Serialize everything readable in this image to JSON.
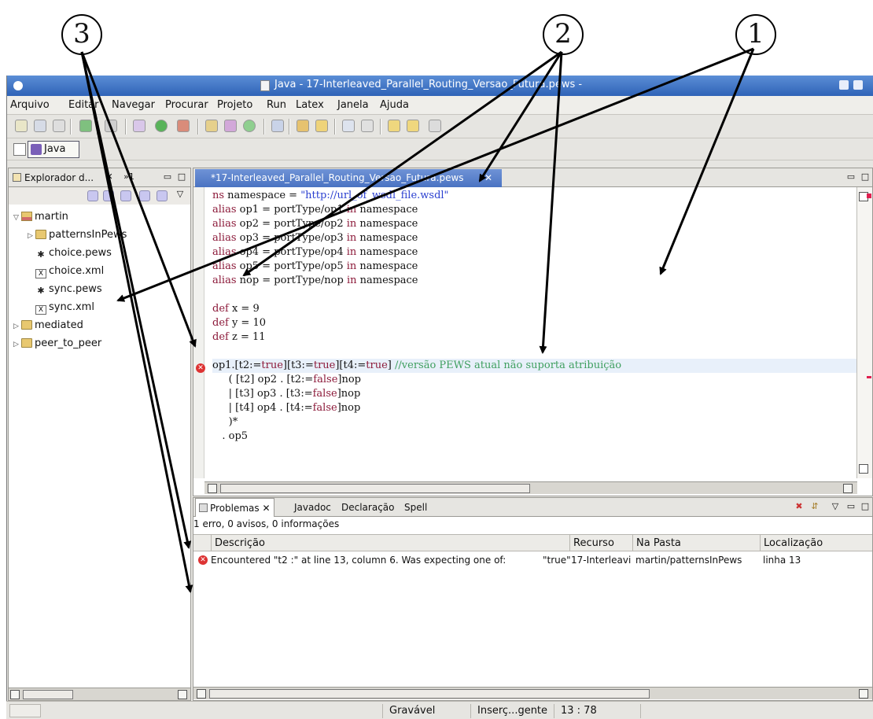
{
  "callouts": [
    "3",
    "2",
    "1"
  ],
  "window": {
    "title": "Java - 17-Interleaved_Parallel_Routing_Versao_Futura.pews -"
  },
  "menu": [
    "Arquivo",
    "Editar",
    "Navegar",
    "Procurar",
    "Projeto",
    "Run",
    "Latex",
    "Janela",
    "Ajuda"
  ],
  "perspective": {
    "java_label": "Java"
  },
  "explorer": {
    "title": "Explorador d...",
    "overflow": "»1",
    "tree": [
      {
        "label": "martin",
        "type": "project",
        "depth": 0,
        "twisty": "▽"
      },
      {
        "label": "patternsInPews",
        "type": "folder",
        "depth": 1,
        "twisty": "▷"
      },
      {
        "label": "choice.pews",
        "type": "pews",
        "depth": 1,
        "twisty": ""
      },
      {
        "label": "choice.xml",
        "type": "xml",
        "depth": 1,
        "twisty": ""
      },
      {
        "label": "sync.pews",
        "type": "pews",
        "depth": 1,
        "twisty": ""
      },
      {
        "label": "sync.xml",
        "type": "xml",
        "depth": 1,
        "twisty": ""
      },
      {
        "label": "mediated",
        "type": "folder",
        "depth": 0,
        "twisty": "▷"
      },
      {
        "label": "peer_to_peer",
        "type": "folder",
        "depth": 0,
        "twisty": "▷"
      }
    ]
  },
  "editor": {
    "tab_label": "*17-Interleaved_Parallel_Routing_Versao_Futura.pews",
    "code": [
      [
        [
          "kw",
          "ns"
        ],
        [
          "t",
          " namespace = "
        ],
        [
          "str",
          "\"http://url_of_wsdl_file.wsdl\""
        ]
      ],
      [
        [
          "kw",
          "alias"
        ],
        [
          "t",
          " op1 = portType/op1 "
        ],
        [
          "kw",
          "in"
        ],
        [
          "t",
          " namespace"
        ]
      ],
      [
        [
          "kw",
          "alias"
        ],
        [
          "t",
          " op2 = portType/op2 "
        ],
        [
          "kw",
          "in"
        ],
        [
          "t",
          " namespace"
        ]
      ],
      [
        [
          "kw",
          "alias"
        ],
        [
          "t",
          " op3 = portType/op3 "
        ],
        [
          "kw",
          "in"
        ],
        [
          "t",
          " namespace"
        ]
      ],
      [
        [
          "kw",
          "alias"
        ],
        [
          "t",
          " op4 = portType/op4 "
        ],
        [
          "kw",
          "in"
        ],
        [
          "t",
          " namespace"
        ]
      ],
      [
        [
          "kw",
          "alias"
        ],
        [
          "t",
          " op5 = portType/op5 "
        ],
        [
          "kw",
          "in"
        ],
        [
          "t",
          " namespace"
        ]
      ],
      [
        [
          "kw",
          "alias"
        ],
        [
          "t",
          " nop = portType/nop "
        ],
        [
          "kw",
          "in"
        ],
        [
          "t",
          " namespace"
        ]
      ],
      [
        [
          "t",
          ""
        ]
      ],
      [
        [
          "kw",
          "def"
        ],
        [
          "t",
          " x = 9"
        ]
      ],
      [
        [
          "kw",
          "def"
        ],
        [
          "t",
          " y = 10"
        ]
      ],
      [
        [
          "kw",
          "def"
        ],
        [
          "t",
          " z = 11"
        ]
      ],
      [
        [
          "t",
          ""
        ]
      ],
      [
        [
          "t",
          "op1.[t2:="
        ],
        [
          "kw",
          "true"
        ],
        [
          "t",
          "][t3:="
        ],
        [
          "kw",
          "true"
        ],
        [
          "t",
          "][t4:="
        ],
        [
          "kw",
          "true"
        ],
        [
          "t",
          "] "
        ],
        [
          "cm",
          "//versão PEWS atual não suporta atribuição"
        ]
      ],
      [
        [
          "t",
          "     ( [t2] op2 . [t2:="
        ],
        [
          "kw",
          "false"
        ],
        [
          "t",
          "]nop"
        ]
      ],
      [
        [
          "t",
          "     | [t3] op3 . [t3:="
        ],
        [
          "kw",
          "false"
        ],
        [
          "t",
          "]nop"
        ]
      ],
      [
        [
          "t",
          "     | [t4] op4 . [t4:="
        ],
        [
          "kw",
          "false"
        ],
        [
          "t",
          "]nop"
        ]
      ],
      [
        [
          "t",
          "     )*"
        ]
      ],
      [
        [
          "t",
          "   . op5"
        ]
      ]
    ]
  },
  "problems": {
    "tabs": [
      "Problemas",
      "Javadoc",
      "Declaração",
      "Spell"
    ],
    "summary": "1 erro, 0 avisos, 0 informações",
    "columns": [
      "Descrição",
      "Recurso",
      "Na Pasta",
      "Localização"
    ],
    "rows": [
      {
        "description": "Encountered \"t2 :\" at line 13, column 6. Was expecting one of:",
        "extra": "\"true\"",
        "resource": "17-Interleavi",
        "folder": "martin/patternsInPews",
        "location": "linha 13"
      }
    ]
  },
  "status": {
    "writable": "Gravável",
    "insert": "Inserç...gente",
    "position": "13 : 78"
  }
}
